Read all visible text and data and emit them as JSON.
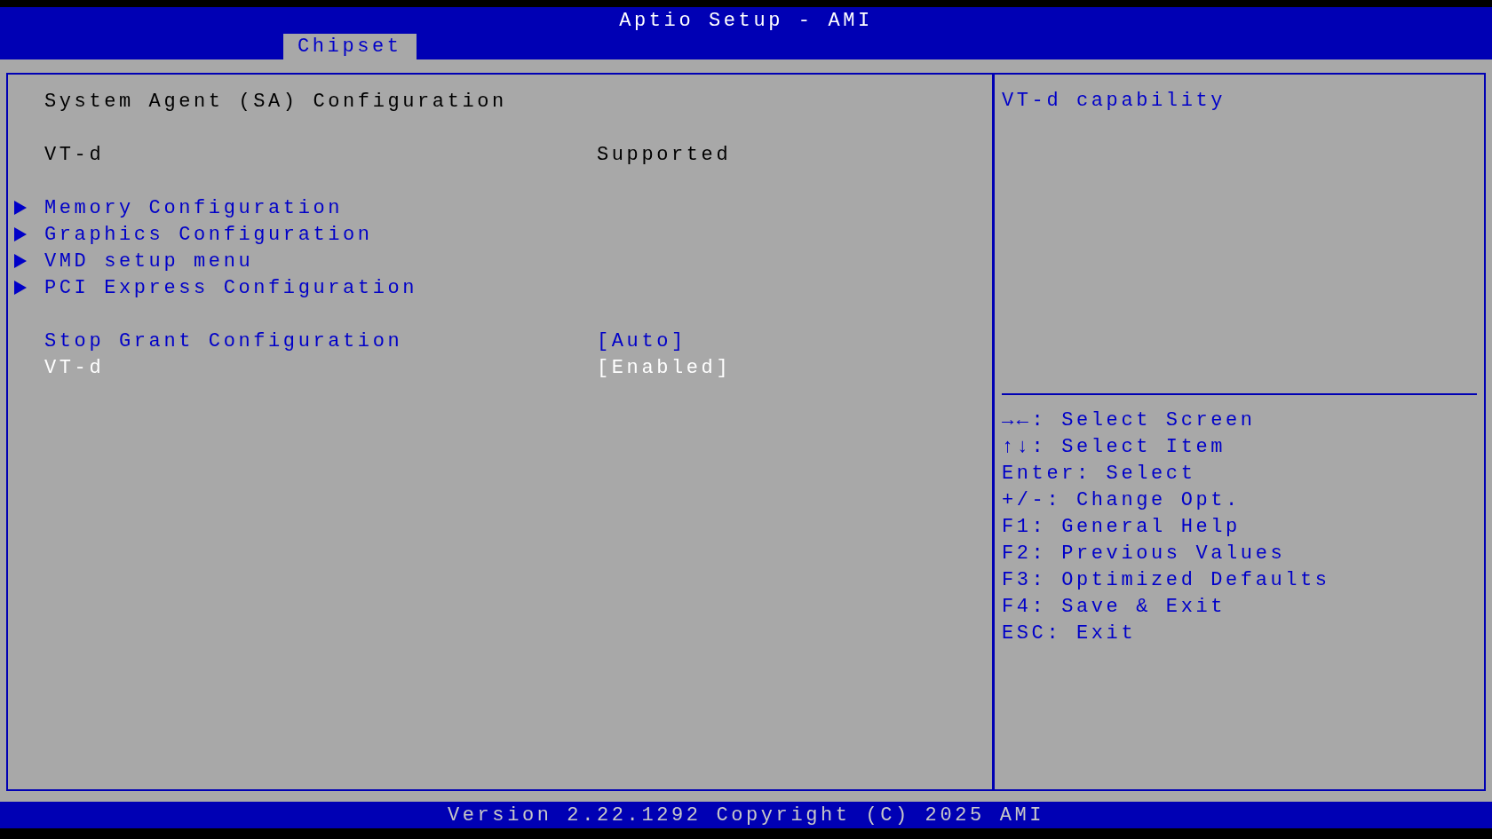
{
  "window": {
    "title": "Aptio Setup - AMI"
  },
  "tabs": [
    {
      "label": "Chipset",
      "selected": true
    }
  ],
  "main": {
    "items": [
      {
        "kind": "heading",
        "label": "System Agent (SA) Configuration",
        "selected": false
      },
      {
        "kind": "gap"
      },
      {
        "kind": "info",
        "label": "VT-d",
        "value": "Supported",
        "selected": false
      },
      {
        "kind": "gap"
      },
      {
        "kind": "submenu",
        "label": "Memory Configuration",
        "selected": false
      },
      {
        "kind": "submenu",
        "label": "Graphics Configuration",
        "selected": false
      },
      {
        "kind": "submenu",
        "label": "VMD setup menu",
        "selected": false
      },
      {
        "kind": "submenu",
        "label": "PCI Express Configuration",
        "selected": false
      },
      {
        "kind": "gap"
      },
      {
        "kind": "option",
        "label": "Stop Grant Configuration",
        "value": "[Auto]",
        "selected": false
      },
      {
        "kind": "option",
        "label": "VT-d",
        "value": "[Enabled]",
        "selected": true
      }
    ]
  },
  "help": {
    "text": "VT-d capability",
    "keys": [
      "→←: Select Screen",
      "↑↓: Select Item",
      "Enter: Select",
      "+/-: Change Opt.",
      "F1: General Help",
      "F2: Previous Values",
      "F3: Optimized Defaults",
      "F4: Save & Exit",
      "ESC: Exit"
    ]
  },
  "status_bar": "Version 2.22.1292 Copyright (C) 2025 AMI"
}
